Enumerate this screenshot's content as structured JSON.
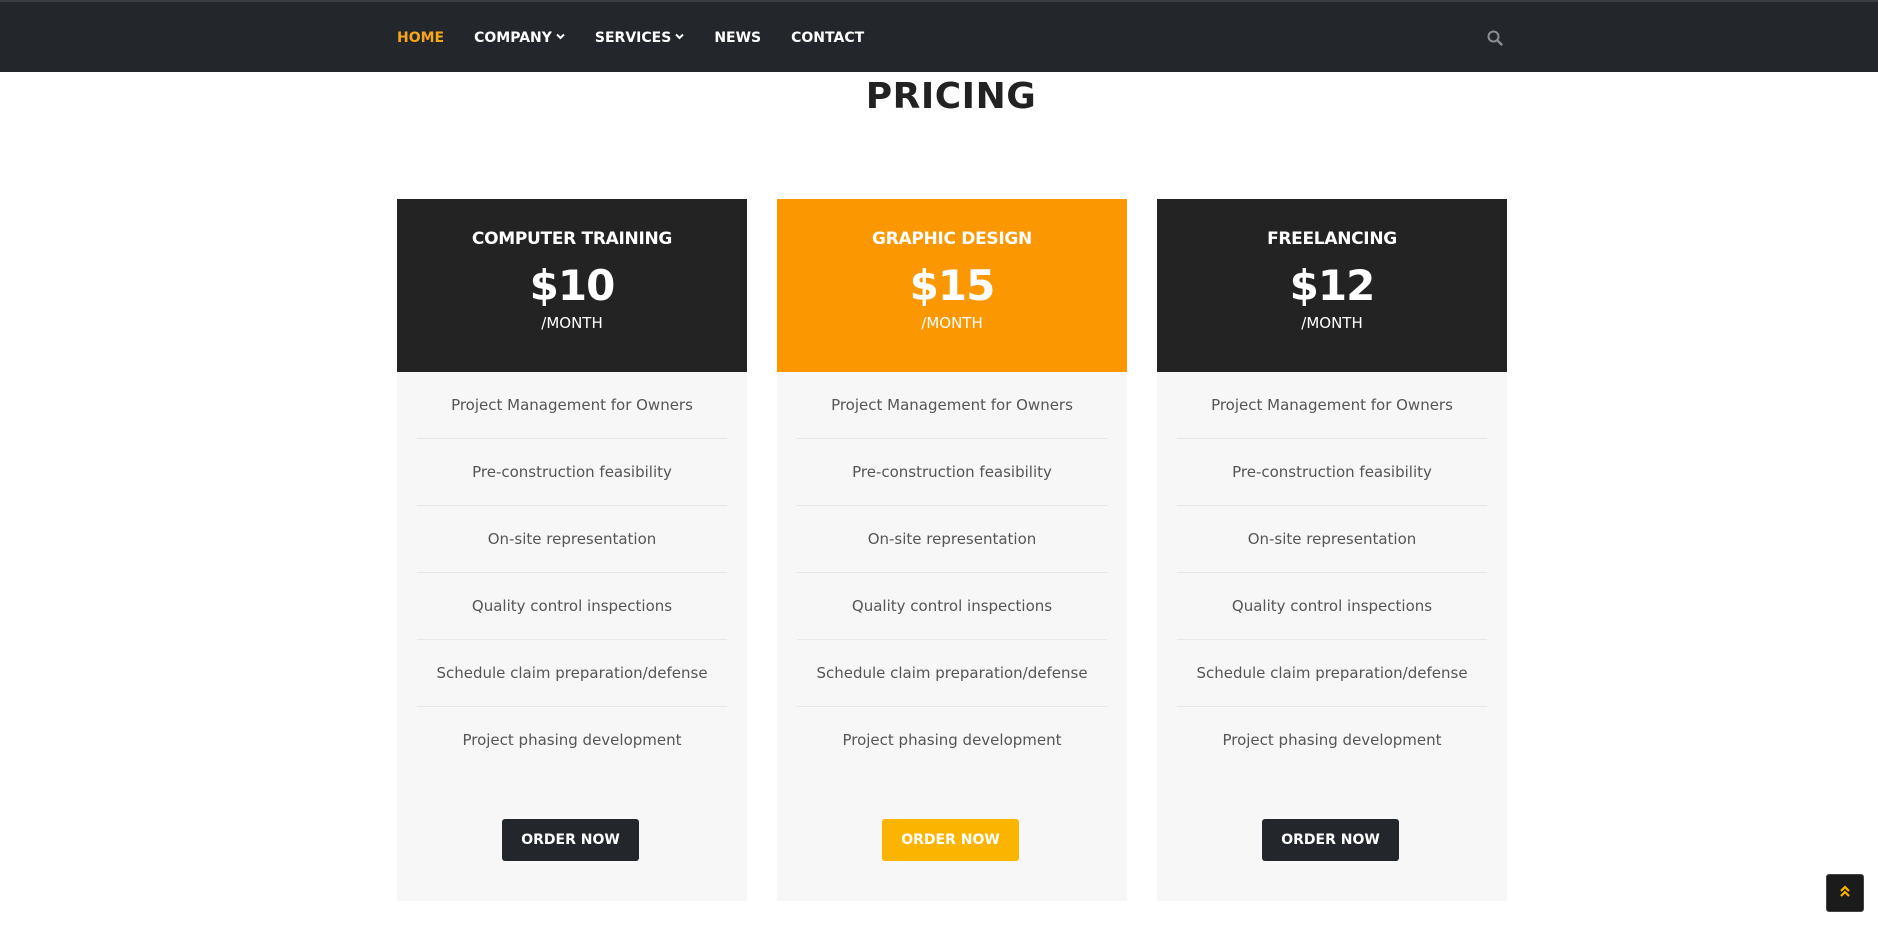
{
  "nav": {
    "items": [
      {
        "label": "HOME",
        "active": true,
        "dropdown": false
      },
      {
        "label": "COMPANY",
        "active": false,
        "dropdown": true
      },
      {
        "label": "SERVICES",
        "active": false,
        "dropdown": true
      },
      {
        "label": "NEWS",
        "active": false,
        "dropdown": false
      },
      {
        "label": "CONTACT",
        "active": false,
        "dropdown": false
      }
    ],
    "search_icon": "search-icon",
    "active_color": "#f9a51a",
    "bar_color": "#23272b"
  },
  "page": {
    "title": "PRICING"
  },
  "plans": [
    {
      "name": "COMPUTER TRAINING",
      "price": "$10",
      "period": "/MONTH",
      "header_color": "#232323",
      "features": [
        "Project Management for Owners",
        "Pre-construction feasibility",
        "On-site representation",
        "Quality control inspections",
        "Schedule claim preparation/defense",
        "Project phasing development"
      ],
      "button_label": "ORDER NOW",
      "button_color": "#23272b"
    },
    {
      "name": "GRAPHIC DESIGN",
      "price": "$15",
      "period": "/MONTH",
      "header_color": "#fb9801",
      "features": [
        "Project Management for Owners",
        "Pre-construction feasibility",
        "On-site representation",
        "Quality control inspections",
        "Schedule claim preparation/defense",
        "Project phasing development"
      ],
      "button_label": "ORDER NOW",
      "button_color": "#fbb500"
    },
    {
      "name": "FREELANCING",
      "price": "$12",
      "period": "/MONTH",
      "header_color": "#232323",
      "features": [
        "Project Management for Owners",
        "Pre-construction feasibility",
        "On-site representation",
        "Quality control inspections",
        "Schedule claim preparation/defense",
        "Project phasing development"
      ],
      "button_label": "ORDER NOW",
      "button_color": "#23272b"
    }
  ],
  "back_to_top": {
    "icon": "double-chevron-up-icon"
  }
}
